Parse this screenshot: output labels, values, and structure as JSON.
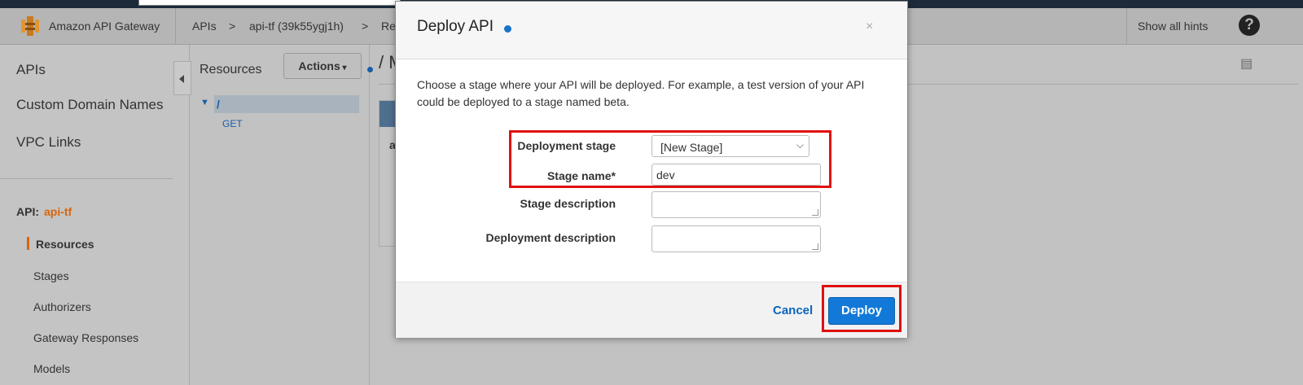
{
  "header": {
    "brand": "Amazon API Gateway",
    "breadcrumb": [
      "APIs",
      ">",
      "api-tf (39k55ygj1h)",
      ">",
      "Re"
    ],
    "show_hints": "Show all hints",
    "help_icon": "?"
  },
  "sidebar": {
    "top_items": [
      "APIs",
      "Custom Domain Names",
      "VPC Links"
    ],
    "api_label": "API:",
    "api_name": "api-tf",
    "sections": [
      "Resources",
      "Stages",
      "Authorizers",
      "Gateway Responses",
      "Models"
    ]
  },
  "resources": {
    "title": "Resources",
    "actions_label": "Actions",
    "tree_root": "/",
    "tree_method": "GET",
    "path_title": "/ M",
    "card_text": "a"
  },
  "modal": {
    "title": "Deploy API",
    "close_label": "×",
    "intro": "Choose a stage where your API will be deployed. For example, a test version of your API could be deployed to a stage named beta.",
    "fields": {
      "deployment_stage_label": "Deployment stage",
      "deployment_stage_value": "[New Stage]",
      "stage_name_label": "Stage name*",
      "stage_name_value": "dev",
      "stage_description_label": "Stage description",
      "deployment_description_label": "Deployment description"
    },
    "cancel_label": "Cancel",
    "deploy_label": "Deploy"
  },
  "colors": {
    "accent_blue": "#1279d8",
    "highlight_red": "#e01010",
    "api_name_orange": "#d9640c"
  }
}
